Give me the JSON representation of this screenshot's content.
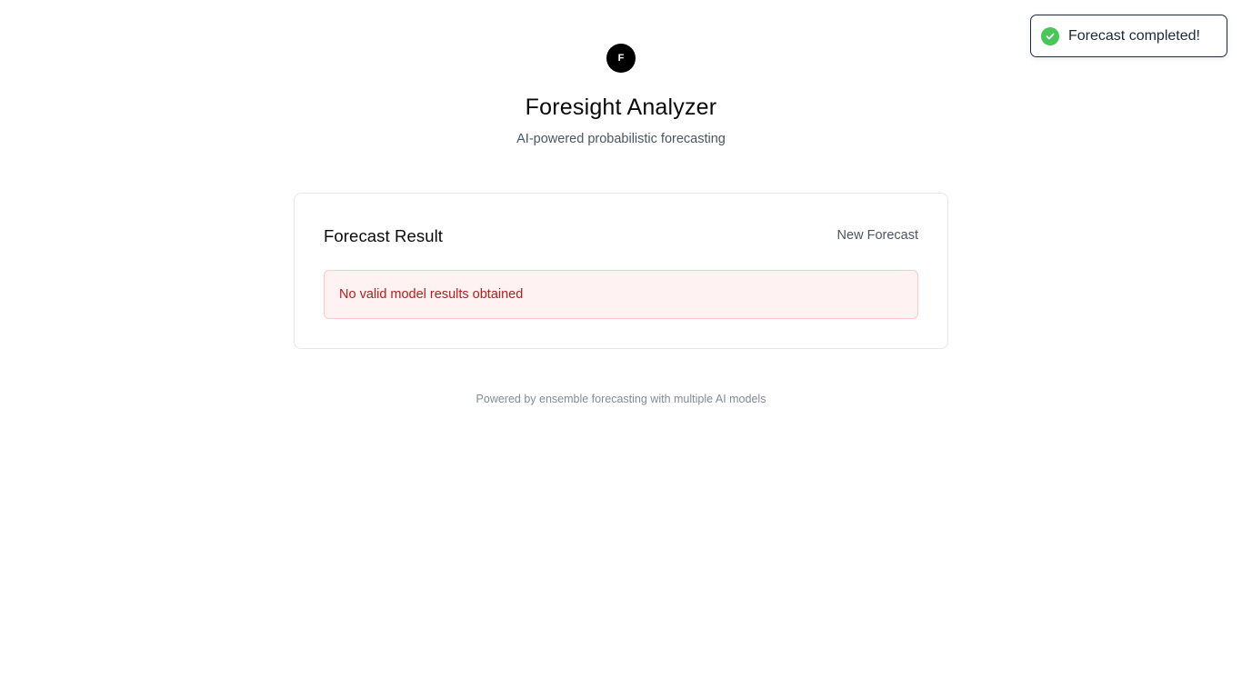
{
  "header": {
    "logo_letter": "F",
    "title": "Foresight Analyzer",
    "subtitle": "AI-powered probabilistic forecasting"
  },
  "result_card": {
    "title": "Forecast Result",
    "new_forecast_label": "New Forecast",
    "error_message": "No valid model results obtained"
  },
  "footer": {
    "text": "Powered by ensemble forecasting with multiple AI models"
  },
  "toast": {
    "icon": "check-circle-icon",
    "message": "Forecast completed!",
    "status_color": "#48c759"
  },
  "colors": {
    "error_bg": "#fef2f2",
    "error_border": "#fecaca",
    "error_text": "#b91c1c"
  }
}
